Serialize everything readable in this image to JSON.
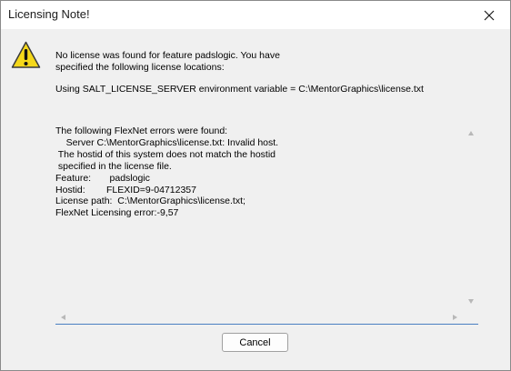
{
  "window": {
    "title": "Licensing Note!"
  },
  "message": {
    "line1": "No license was found for feature padslogic.  You have",
    "line2": "specified the following license locations:",
    "env": "Using SALT_LICENSE_SERVER environment variable = C:\\MentorGraphics\\license.txt"
  },
  "errors": {
    "text": "The following FlexNet errors were found:\n    Server C:\\MentorGraphics\\license.txt: Invalid host.\n The hostid of this system does not match the hostid\n specified in the license file.\nFeature:       padslogic\nHostid:        FLEXID=9-04712357\nLicense path:  C:\\MentorGraphics\\license.txt;\nFlexNet Licensing error:-9,57"
  },
  "buttons": {
    "cancel": "Cancel"
  },
  "icons": {
    "warning": "warning-icon",
    "close": "close-icon"
  },
  "colors": {
    "warning_fill": "#f5d81a",
    "focus_border": "#4a7fc1"
  }
}
